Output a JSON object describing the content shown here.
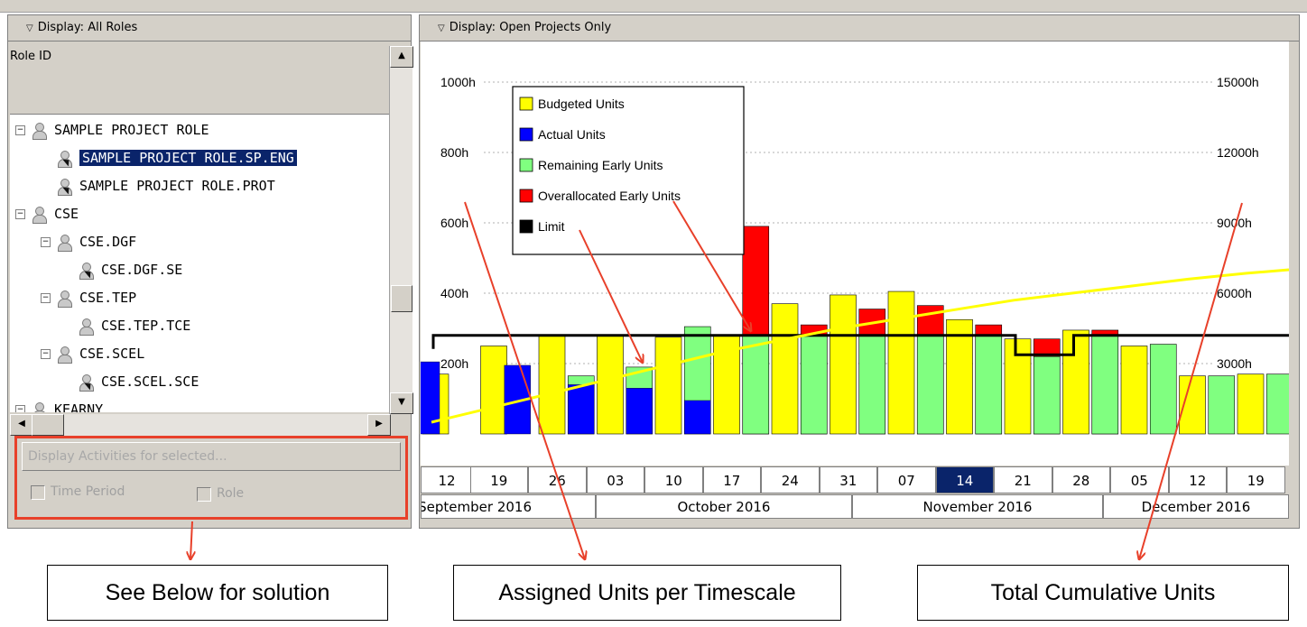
{
  "left_pane": {
    "header": "Display: All Roles",
    "column_header": "Role ID",
    "tree": [
      {
        "label": "SAMPLE PROJECT ROLE",
        "level": 0,
        "expanded": true,
        "icon": "role-icon"
      },
      {
        "label": "SAMPLE PROJECT ROLE.SP.ENG",
        "level": 1,
        "selected": true,
        "icon": "role-assigned-icon"
      },
      {
        "label": "SAMPLE PROJECT ROLE.PROT",
        "level": 1,
        "icon": "role-assigned-icon"
      },
      {
        "label": "CSE",
        "level": 0,
        "expanded": true,
        "icon": "role-icon"
      },
      {
        "label": "CSE.DGF",
        "level": 1,
        "expanded": true,
        "icon": "role-icon"
      },
      {
        "label": "CSE.DGF.SE",
        "level": 2,
        "icon": "role-assigned-icon"
      },
      {
        "label": "CSE.TEP",
        "level": 1,
        "expanded": true,
        "icon": "role-icon"
      },
      {
        "label": "CSE.TEP.TCE",
        "level": 2,
        "icon": "role-icon"
      },
      {
        "label": "CSE.SCEL",
        "level": 1,
        "expanded": true,
        "icon": "role-icon"
      },
      {
        "label": "CSE.SCEL.SCE",
        "level": 2,
        "icon": "role-assigned-icon"
      },
      {
        "label": "KEARNY",
        "level": 0,
        "expanded": true,
        "icon": "role-icon"
      }
    ],
    "display_activities_button": "Display Activities for selected...",
    "time_period_label": "Time Period",
    "role_label": "Role",
    "time_period_checked": false,
    "role_checked": false
  },
  "right_pane": {
    "header": "Display: Open Projects Only",
    "legend": [
      {
        "label": "Budgeted Units",
        "color": "#ffff00"
      },
      {
        "label": "Actual Units",
        "color": "#0000ff"
      },
      {
        "label": "Remaining Early Units",
        "color": "#80ff80"
      },
      {
        "label": "Overallocated Early Units",
        "color": "#ff0000"
      },
      {
        "label": "Limit",
        "color": "#000000"
      }
    ],
    "weeks": [
      "12",
      "19",
      "26",
      "03",
      "10",
      "17",
      "24",
      "31",
      "07",
      "14",
      "21",
      "28",
      "05",
      "12",
      "19"
    ],
    "current_week": "14",
    "months": [
      "September 2016",
      "October 2016",
      "November 2016",
      "December 2016"
    ]
  },
  "chart_data": {
    "type": "bar",
    "categories": [
      "12",
      "19",
      "26",
      "03",
      "10",
      "17",
      "24",
      "31",
      "07",
      "14",
      "21",
      "28",
      "05",
      "12",
      "19"
    ],
    "y_left_ticks": [
      "200h",
      "400h",
      "600h",
      "800h",
      "1000h"
    ],
    "y_right_ticks": [
      "3000h",
      "6000h",
      "9000h",
      "12000h",
      "15000h"
    ],
    "y_left_range": [
      0,
      1150
    ],
    "y_right_range": [
      0,
      17250
    ],
    "grid": true,
    "legend_position": "top-left",
    "series": [
      {
        "name": "Budgeted Units",
        "color": "#ffff00",
        "values": [
          170,
          250,
          280,
          280,
          275,
          280,
          370,
          395,
          405,
          325,
          270,
          295,
          250,
          165,
          170
        ]
      },
      {
        "name": "Actual Units",
        "color": "#0000ff",
        "values": [
          205,
          195,
          140,
          130,
          95,
          0,
          0,
          0,
          0,
          0,
          0,
          0,
          0,
          0,
          0
        ]
      },
      {
        "name": "Remaining Early Units",
        "color": "#80ff80",
        "values": [
          0,
          0,
          165,
          190,
          305,
          280,
          280,
          280,
          280,
          280,
          220,
          280,
          255,
          165,
          170
        ]
      },
      {
        "name": "Overallocated Early Units",
        "color": "#ff0000",
        "values": [
          0,
          0,
          0,
          0,
          0,
          590,
          310,
          355,
          365,
          310,
          270,
          295,
          0,
          0,
          0
        ]
      }
    ],
    "limit": [
      280,
      280,
      280,
      280,
      280,
      280,
      280,
      280,
      280,
      280,
      225,
      280,
      280,
      280,
      280
    ],
    "cumulative_right_axis": [
      500,
      1100,
      1700,
      2300,
      2900,
      3500,
      4000,
      4500,
      4900,
      5300,
      5700,
      6000,
      6300,
      6600,
      6850
    ]
  },
  "callouts": [
    {
      "text": "See Below for solution"
    },
    {
      "text": "Assigned Units per Timescale"
    },
    {
      "text": "Total Cumulative Units"
    }
  ],
  "colors": {
    "annotation_red": "#e8402a",
    "selection_blue": "#0a246a",
    "window_gray": "#d4d0c8"
  }
}
